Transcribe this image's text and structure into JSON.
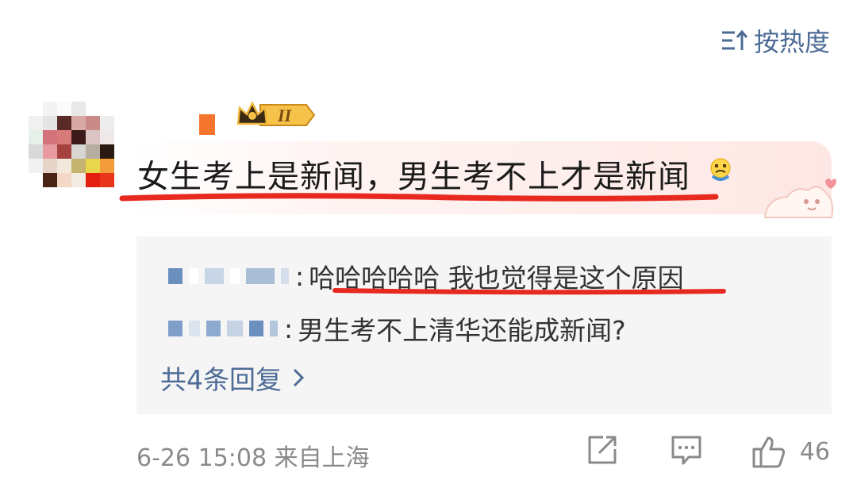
{
  "sort": {
    "label": "按热度",
    "icon": "sort-hot-icon"
  },
  "comment": {
    "text": "女生考上是新闻，男生考不上才是新闻",
    "emoji": "crying-face-emoji",
    "level_badge": "II",
    "badge_icon": "crown-icon"
  },
  "replies": [
    {
      "sep": ":",
      "text": "哈哈哈哈哈 我也觉得是这个原因"
    },
    {
      "sep": ":",
      "text": "男生考不上清华还能成新闻?"
    }
  ],
  "more_replies": "共4条回复",
  "footer": {
    "meta": "6-26 15:08 来自上海",
    "like_count": "46"
  },
  "colors": {
    "link": "#4d6b96",
    "underline": "#e8291f",
    "reply_bg": "#f5f5f5"
  }
}
